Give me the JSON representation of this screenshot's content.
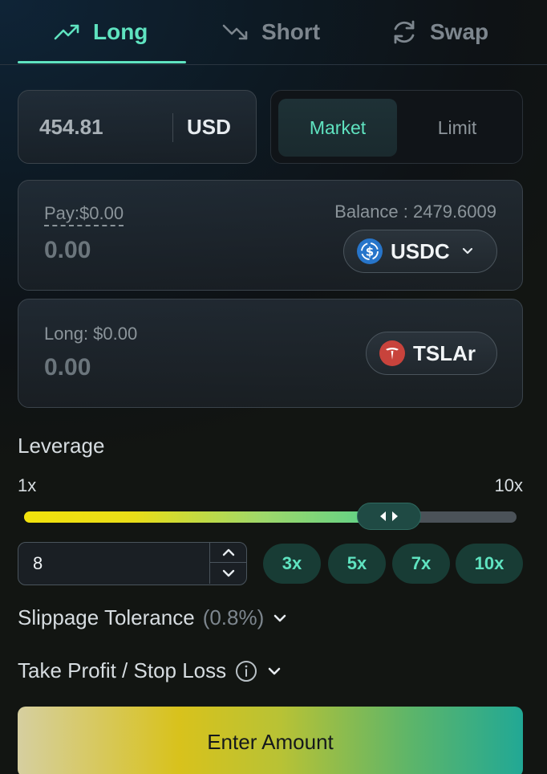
{
  "tabs": [
    {
      "label": "Long",
      "icon": "trend-up-icon",
      "active": true
    },
    {
      "label": "Short",
      "icon": "trend-down-icon",
      "active": false
    },
    {
      "label": "Swap",
      "icon": "refresh-icon",
      "active": false
    }
  ],
  "price": {
    "value": "454.81",
    "unit": "USD"
  },
  "order_type": {
    "options": [
      "Market",
      "Limit"
    ],
    "selected": "Market"
  },
  "pay": {
    "label": "Pay:$0.00",
    "amount": "0.00",
    "balance": "Balance : 2479.6009",
    "token": "USDC",
    "token_icon": "usdc-icon"
  },
  "long": {
    "label": "Long: $0.00",
    "amount": "0.00",
    "token": "TSLAr",
    "token_icon": "tesla-icon"
  },
  "leverage": {
    "title": "Leverage",
    "min_label": "1x",
    "max_label": "10x",
    "min": 1,
    "max": 10,
    "value": 8,
    "input_value": "8",
    "presets": [
      "3x",
      "5x",
      "7x",
      "10x"
    ]
  },
  "slippage": {
    "label": "Slippage Tolerance",
    "value": "(0.8%)"
  },
  "tpsl": {
    "label": "Take Profit / Stop Loss"
  },
  "cta": {
    "label": "Enter Amount"
  },
  "colors": {
    "accent": "#5fe3c0",
    "background": "#0e1215"
  }
}
